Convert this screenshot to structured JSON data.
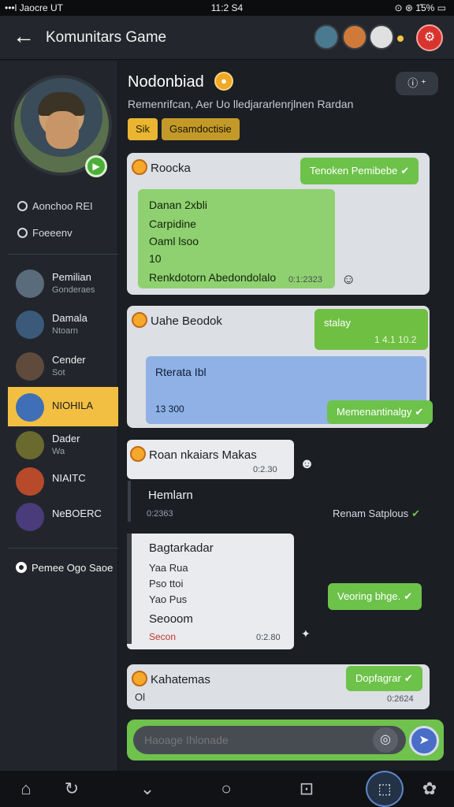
{
  "status": {
    "left": "•••l Jaocre UT",
    "time": "11:2 S4",
    "right": "⊙ ⊛ 1̂5% ▭"
  },
  "appbar": {
    "title": "Komunitars Game"
  },
  "group": {
    "title": "Nodonbiad",
    "subtitle": "Remenrifcan, Aer Uo lledjararlenrjlnen Rardan",
    "tags": [
      "Sik",
      "Gsamdoctisie"
    ]
  },
  "sidebar": {
    "filters": [
      "Aonchoo REI",
      "Foeeenv"
    ],
    "members": [
      {
        "name": "Pemilian",
        "sub": "Gonderaes",
        "color": "#5a6c7c"
      },
      {
        "name": "Damala",
        "sub": "Ntoarn",
        "color": "#3b5a7a"
      },
      {
        "name": "Cender",
        "sub": "Sot",
        "color": "#5f4a3b"
      },
      {
        "name": "NIOHILA",
        "sub": "",
        "color": "#3f6fb6"
      },
      {
        "name": "Dader",
        "sub": "Wa",
        "color": "#6a6a2f"
      },
      {
        "name": "NIAITC",
        "sub": "",
        "color": "#b64a2a"
      },
      {
        "name": "NeBOERC",
        "sub": "",
        "color": "#4a3b7a"
      }
    ],
    "create": "Pemee Ogo Saoe"
  },
  "messages": {
    "m1": {
      "head": "Roocka",
      "chip": "Tenoken Pemibebe",
      "lines": [
        "Danan 2xbli",
        "Carpidine",
        "Oaml lsoo",
        "10",
        "Renkdotorn Abedondolalo"
      ],
      "time": "0:1:2323"
    },
    "m2": {
      "head": "Uahe Beodok",
      "green": "stalay",
      "gtime": "1 4.1 10.2",
      "blue": "Rterata Ibl",
      "btime": "13 300",
      "chip": "Memenantinalgy"
    },
    "m3": {
      "head": "Roan nkaiars Makas",
      "time": "0:2.30",
      "title": "Hemlarn",
      "time2": "0:2363",
      "right": "Renam Satplous"
    },
    "m4": {
      "head": "Bagtarkadar",
      "lines": [
        "Yaa Rua",
        "Pso ttoi",
        "Yao Pus"
      ],
      "foot": "Seooom",
      "foot2": "Secon",
      "time": "0:2.80",
      "chip": "Veoring bhge."
    },
    "m5": {
      "head": "Kahatemas",
      "sub": "Ol",
      "chip": "Dopfagrar",
      "time": "0:2624"
    }
  },
  "composer": {
    "placeholder": "Haoage Ihlonade"
  },
  "colors": {
    "accent": "#6fc24c",
    "active": "#f2bf43",
    "bg": "#1b1e23"
  }
}
